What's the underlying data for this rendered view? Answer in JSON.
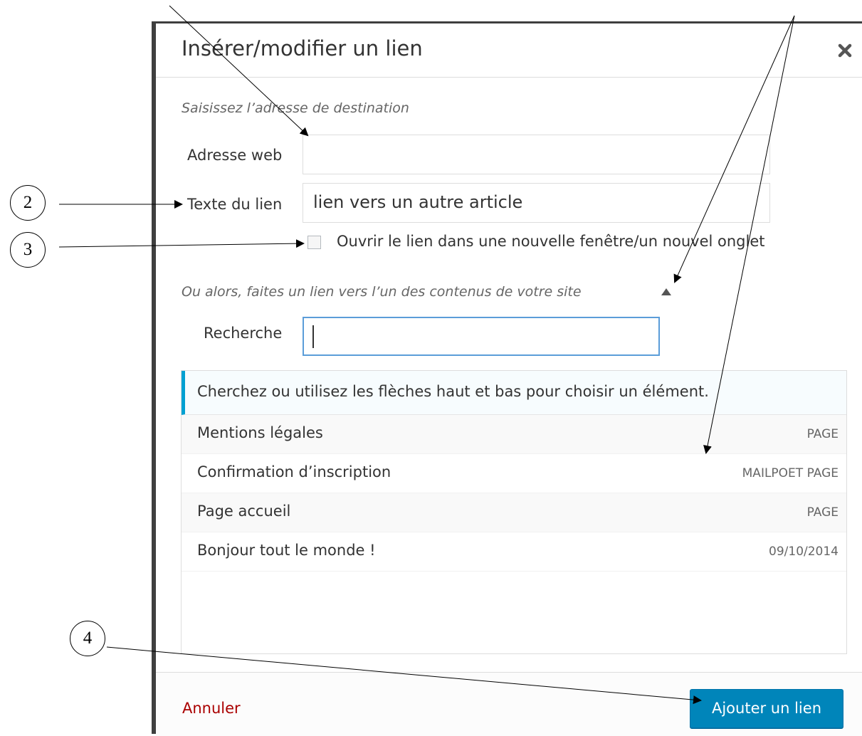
{
  "dialog": {
    "title": "Insérer/modifier un lien",
    "close_icon": "close-icon"
  },
  "destination": {
    "intro": "Saisissez l’adresse de destination",
    "url_label": "Adresse web",
    "url_value": "",
    "link_text_label": "Texte du lien",
    "link_text_value": "lien vers un autre article",
    "new_tab_checked": false,
    "new_tab_label": "Ouvrir le lien dans une nouvelle fenêtre/un nouvel onglet"
  },
  "internal": {
    "toggle_label": "Ou alors, faites un lien vers l’un des contenus de votre site",
    "toggle_icon": "triangle-up-icon",
    "search_label": "Recherche",
    "search_value": ""
  },
  "results": {
    "notice": "Cherchez ou utilisez les flèches haut et bas pour choisir un élément.",
    "items": [
      {
        "title": "Mentions légales",
        "meta": "PAGE"
      },
      {
        "title": "Confirmation d’inscription",
        "meta": "MAILPOET PAGE"
      },
      {
        "title": "Page accueil",
        "meta": "PAGE"
      },
      {
        "title": "Bonjour tout le monde !",
        "meta": "09/10/2014"
      }
    ]
  },
  "footer": {
    "cancel_label": "Annuler",
    "submit_label": "Ajouter un lien"
  },
  "annotations": {
    "callouts": [
      "2",
      "3",
      "4"
    ]
  },
  "colors": {
    "accent": "#0085ba",
    "notice_border": "#00a0d2",
    "focus_border": "#5b9dd9",
    "cancel": "#aa0000"
  }
}
